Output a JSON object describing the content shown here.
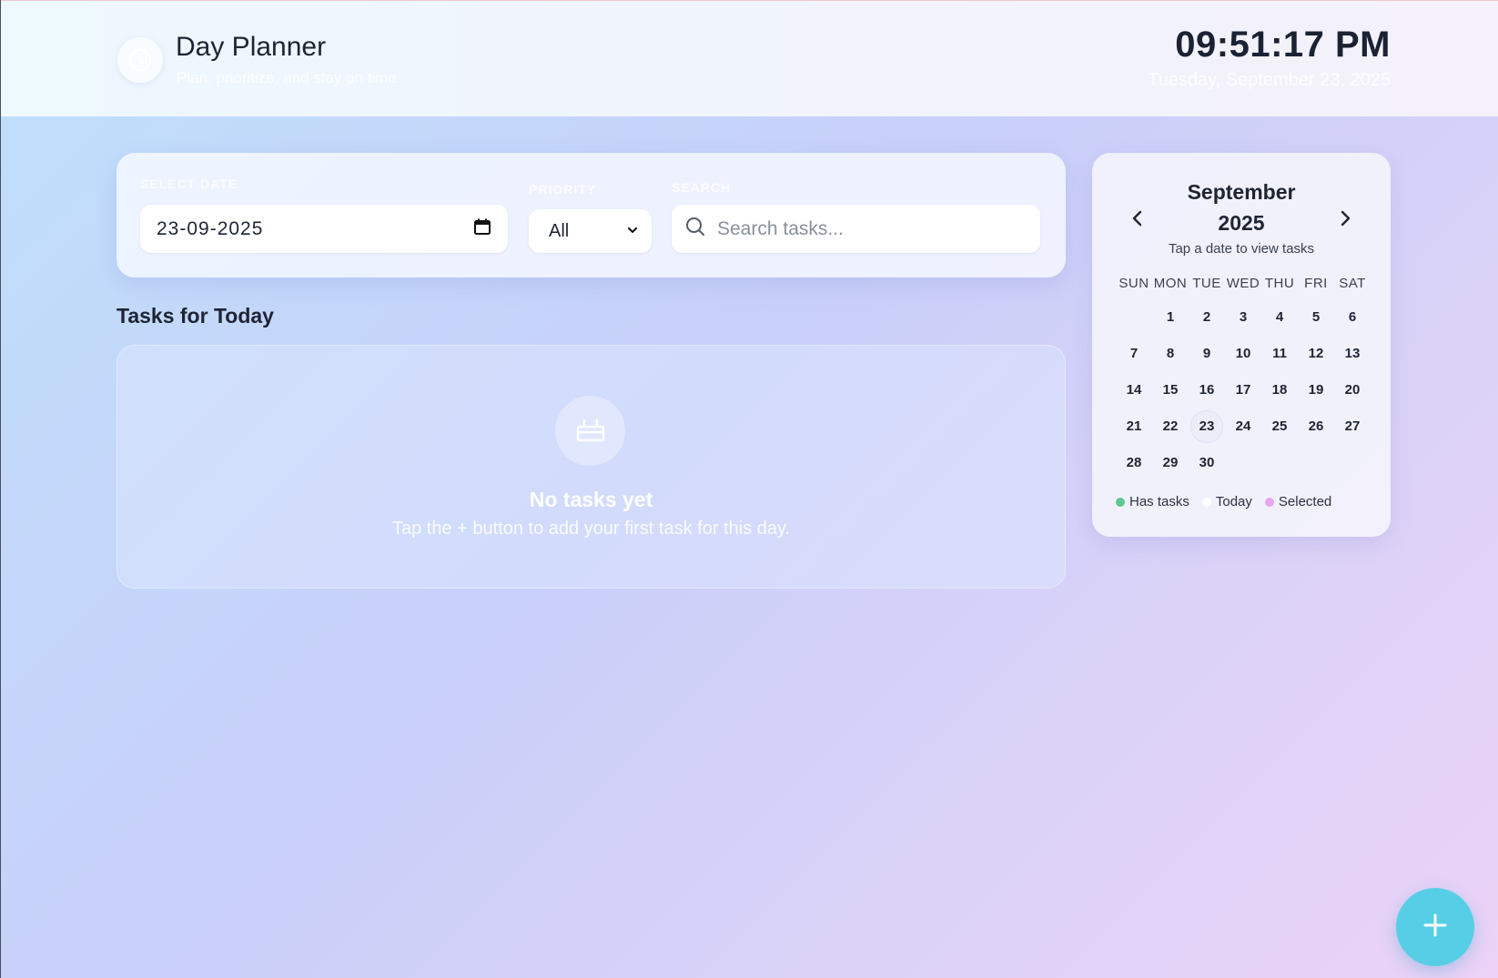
{
  "header": {
    "title": "Day Planner",
    "subtitle": "Plan, prioritize, and stay on time",
    "clock": "09:51:17 PM",
    "date": "Tuesday, September 23, 2025"
  },
  "filters": {
    "date_label": "SELECT DATE",
    "date_value": "23-09-2025",
    "priority_label": "PRIORITY",
    "priority_value": "All",
    "search_label": "SEARCH",
    "search_placeholder": "Search tasks..."
  },
  "tasks": {
    "heading_prefix": "Tasks for",
    "heading_day": "Today",
    "empty_title": "No tasks yet",
    "empty_text": "Tap the + button to add your first task for this day."
  },
  "calendar": {
    "month": "September",
    "year": "2025",
    "hint": "Tap a date to view tasks",
    "weekdays": [
      "SUN",
      "MON",
      "TUE",
      "WED",
      "THU",
      "FRI",
      "SAT"
    ],
    "leading_blanks": 1,
    "days": [
      "1",
      "2",
      "3",
      "4",
      "5",
      "6",
      "7",
      "8",
      "9",
      "10",
      "11",
      "12",
      "13",
      "14",
      "15",
      "16",
      "17",
      "18",
      "19",
      "20",
      "21",
      "22",
      "23",
      "24",
      "25",
      "26",
      "27",
      "28",
      "29",
      "30"
    ],
    "selected_day": "23",
    "legend": [
      {
        "label": "Has tasks",
        "color": "#5cc98f"
      },
      {
        "label": "Today",
        "color": "#ffffff"
      },
      {
        "label": "Selected",
        "color": "#e7a6ec"
      }
    ]
  },
  "colors": {
    "accent": "#56cfe6"
  }
}
